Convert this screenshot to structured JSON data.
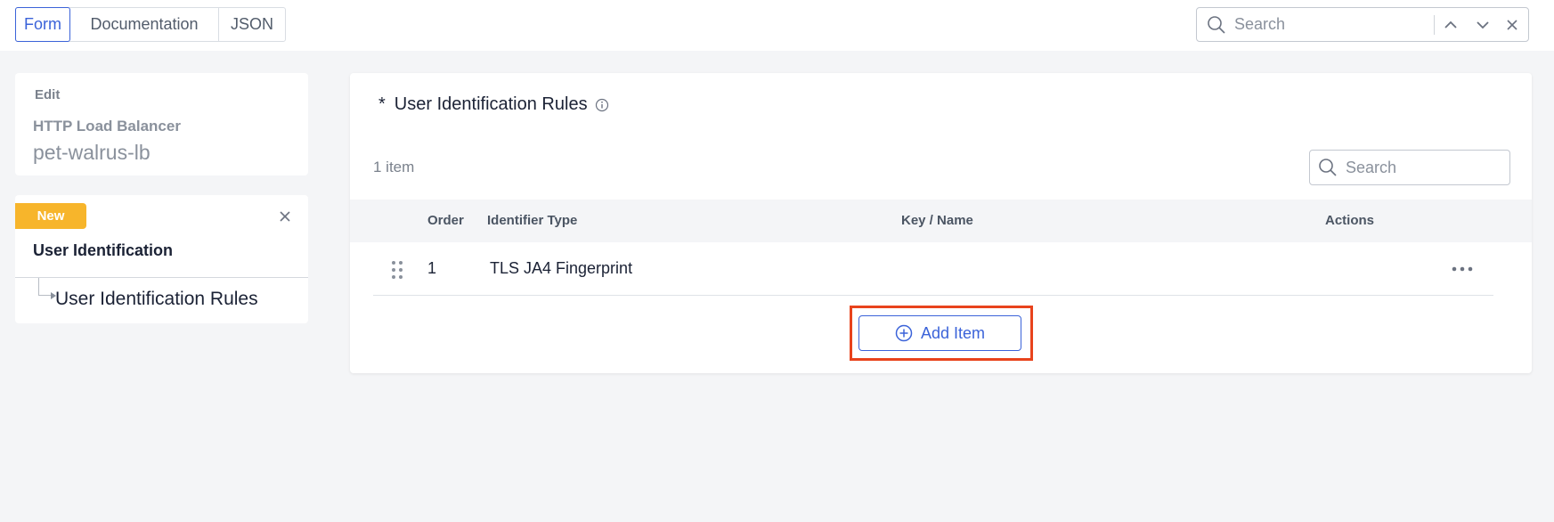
{
  "topbar": {
    "tabs": [
      {
        "label": "Form",
        "active": true
      },
      {
        "label": "Documentation",
        "active": false
      },
      {
        "label": "JSON",
        "active": false
      }
    ],
    "search": {
      "placeholder": "Search"
    }
  },
  "edit_card": {
    "label": "Edit",
    "type": "HTTP Load Balancer",
    "name": "pet-walrus-lb"
  },
  "nav_card": {
    "badge": "New",
    "title": "User Identification",
    "sub_item": "User Identification Rules"
  },
  "main": {
    "required_marker": "*",
    "title": "User Identification Rules",
    "count": "1 item",
    "search": {
      "placeholder": "Search"
    },
    "columns": [
      "Order",
      "Identifier Type",
      "Key / Name",
      "Actions"
    ],
    "rows": [
      {
        "order": "1",
        "identifier_type": "TLS JA4 Fingerprint",
        "key_name": ""
      }
    ],
    "add_button": "Add Item"
  },
  "colors": {
    "accent": "#3b63d9",
    "badge": "#f7b52b",
    "highlight": "#e8431c",
    "background": "#f4f5f7"
  },
  "icons": [
    "search-icon",
    "chevron-up-icon",
    "chevron-down-icon",
    "close-icon",
    "info-icon",
    "drag-handle-icon",
    "more-icon",
    "plus-circle-icon"
  ]
}
